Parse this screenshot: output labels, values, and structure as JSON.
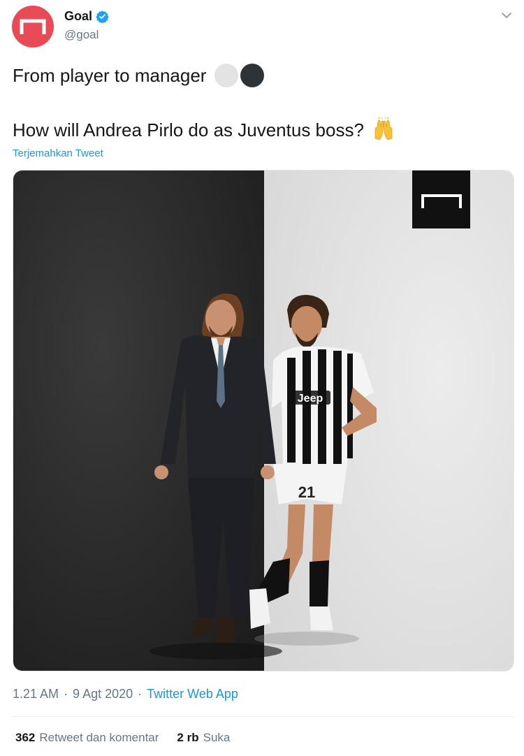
{
  "account": {
    "display_name": "Goal",
    "handle": "@goal",
    "avatar_icon": "goal-logo-icon",
    "verified_icon": "verified-badge-icon",
    "avatar_color": "#e84b55",
    "verified_color": "#1da1f2"
  },
  "tweet": {
    "line1": "From player to manager",
    "line2": "How will Andrea Pirlo do as Juventus boss?",
    "emoji_line1": [
      "white-circle",
      "black-circle"
    ],
    "emoji_line2": "raising-hands-icon",
    "translate_label": "Terjemahkan Tweet"
  },
  "media": {
    "left_bg": "#2a2a2a",
    "right_bg": "#e2e2e2",
    "logo_icon": "goal-logo-icon",
    "jersey_number": "21",
    "jersey_sponsor": "Jeep"
  },
  "meta": {
    "time": "1.21 AM",
    "date": "9 Agt 2020",
    "separator": "·",
    "source": "Twitter Web App"
  },
  "stats": {
    "retweets_count": "362",
    "retweets_label": "Retweet dan komentar",
    "likes_count": "2 rb",
    "likes_label": "Suka"
  },
  "colors": {
    "link": "#1b95e0",
    "muted": "#657786",
    "text": "#14171a"
  }
}
